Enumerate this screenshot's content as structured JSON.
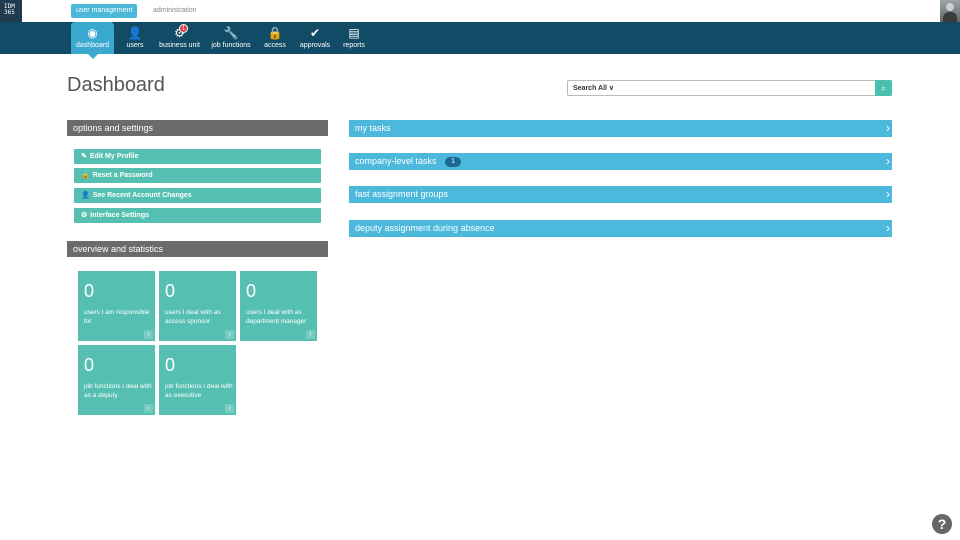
{
  "app": {
    "logo_line1": "IDM",
    "logo_line2": "365"
  },
  "modules": [
    {
      "label": "user management",
      "active": true
    },
    {
      "label": "administration",
      "active": false
    }
  ],
  "nav": [
    {
      "label": "dashboard",
      "icon": "dashboard-icon",
      "glyph": "◉",
      "active": true
    },
    {
      "label": "users",
      "icon": "user-icon",
      "glyph": "👤"
    },
    {
      "label": "business unit",
      "icon": "business-unit-icon",
      "glyph": "⚙",
      "badge": "1"
    },
    {
      "label": "job functions",
      "icon": "wrench-icon",
      "glyph": "🔧"
    },
    {
      "label": "access",
      "icon": "lock-icon",
      "glyph": "🔒"
    },
    {
      "label": "approvals",
      "icon": "check-circle-icon",
      "glyph": "✔"
    },
    {
      "label": "reports",
      "icon": "reports-icon",
      "glyph": "▤"
    }
  ],
  "page_title": "Dashboard",
  "search": {
    "scope_label": "Search All ∨",
    "placeholder": "",
    "button_glyph": "⌕"
  },
  "options_panel": {
    "title": "options and settings",
    "buttons": [
      {
        "label": "Edit My Profile",
        "glyph": "✎"
      },
      {
        "label": "Reset a Password",
        "glyph": "🔒"
      },
      {
        "label": "See Recent Account Changes",
        "glyph": "👤"
      },
      {
        "label": "Interface Settings",
        "glyph": "⚙"
      }
    ]
  },
  "stats_panel": {
    "title": "overview and statistics",
    "tiles": [
      {
        "value": "0",
        "label": "users I am responsible for"
      },
      {
        "value": "0",
        "label": "users I deal with as access sponsor"
      },
      {
        "value": "0",
        "label": "users I deal with as department manager"
      },
      {
        "value": "0",
        "label": "job functions I deal with as a deputy"
      },
      {
        "value": "0",
        "label": "job functions I deal with as executive"
      }
    ]
  },
  "sections": [
    {
      "label": "my tasks"
    },
    {
      "label": "company-level tasks",
      "count": "1"
    },
    {
      "label": "fast assignment groups"
    },
    {
      "label": "deputy assignment during absence"
    }
  ],
  "help_glyph": "?",
  "colors": {
    "navbar": "#124b66",
    "accent": "#4bb8dc",
    "teal": "#55c0b2",
    "panel_head": "#6b6b6b",
    "badge": "#e23b3b"
  }
}
